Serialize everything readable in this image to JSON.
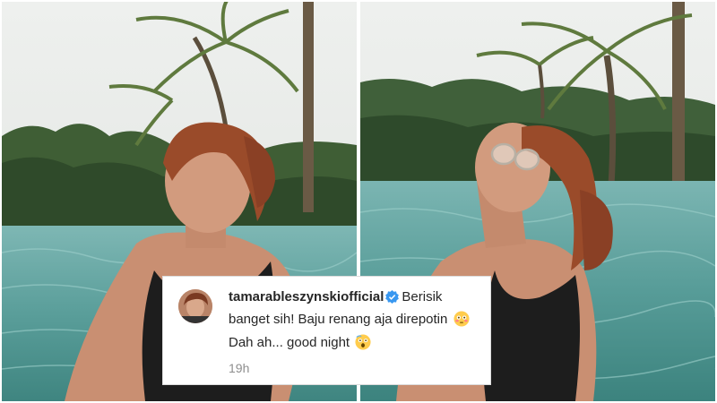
{
  "comment": {
    "username": "tamarableszynskiofficial",
    "text_part1": "Berisik banget sih! Baju renang aja direpotin",
    "text_part2": "Dah ah... good night",
    "timestamp": "19h",
    "verified_icon": "verified-badge-icon",
    "emoji_1": "flushed-face-emoji",
    "emoji_2": "astonished-face-emoji"
  },
  "colors": {
    "verified_blue": "#3897f0",
    "username_text": "#262626",
    "timestamp_text": "#8e8e8e",
    "pool_water": "#5fa39f"
  }
}
